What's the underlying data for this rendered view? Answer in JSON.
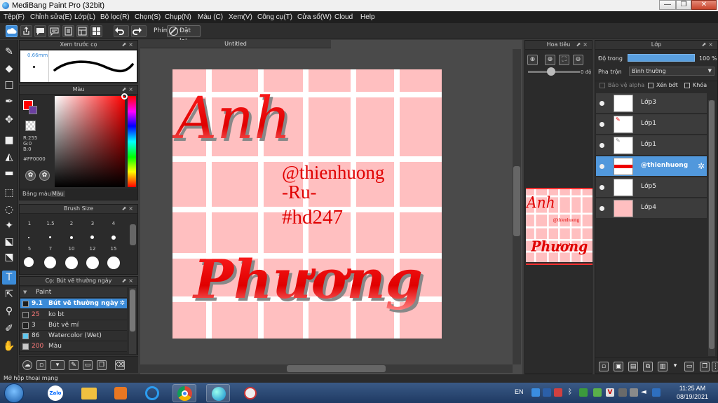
{
  "app": {
    "title": "MediBang Paint Pro (32bit)",
    "window_buttons": [
      "—",
      "❐",
      "✕"
    ]
  },
  "menu": [
    "Tệp(F)",
    "Chỉnh sửa(E)",
    "Lớp(L)",
    "Bộ lọc(R)",
    "Chọn(S)",
    "Chụp(N)",
    "Màu (C)",
    "Xem(V)",
    "Công cụ(T)",
    "Cửa sổ(W)",
    "Cloud",
    "Help"
  ],
  "toolbar": {
    "shortcut_label": "Phím",
    "reset_label": "Đặt lại"
  },
  "brush_preview": {
    "title": "Xem trước cọ",
    "size": "0.66mm"
  },
  "color_panel": {
    "title": "Màu",
    "primary_color": "#ff0000",
    "r": "R:255",
    "g": "G:0",
    "b": "B:0",
    "hex": "#FF0000",
    "tabs": [
      "Bảng màu",
      "Màu"
    ]
  },
  "brush_size": {
    "title": "Brush Size",
    "sizes": [
      "1",
      "1.5",
      "2",
      "3",
      "4",
      "5",
      "7",
      "10",
      "12",
      "15"
    ]
  },
  "brush_list": {
    "title": "Cọ: Bút vẽ thường ngày",
    "group": "Paint",
    "items": [
      {
        "num": "9.1",
        "name": "Bút vẽ thường ngày",
        "color": "#1e1e1e",
        "selected": true
      },
      {
        "num": "25",
        "name": "ko bt",
        "color": "#2a2a2a",
        "selected": false
      },
      {
        "num": "3",
        "name": "Bút vẽ mí",
        "color": "#222222",
        "selected": false
      },
      {
        "num": "86",
        "name": "Watercolor (Wet)",
        "color": "#5ec8f0",
        "selected": false
      },
      {
        "num": "200",
        "name": "Màu",
        "color": "#c8c8c8",
        "selected": false
      }
    ]
  },
  "canvas": {
    "tab_title": "Untitled",
    "art": {
      "word1": "Anh",
      "word2": "Phương",
      "tag1": "@thienhuong",
      "tag2": "-Ru-",
      "tag3": "#hd247"
    }
  },
  "navigator": {
    "title": "Hoa tiêu",
    "angle": "0 độ"
  },
  "layers": {
    "title": "Lớp",
    "opacity_label": "Độ trong",
    "opacity_value": "100 %",
    "opacity": 1.0,
    "blend_label": "Pha trộn",
    "blend_value": "Bình thường",
    "protect_alpha": "Bảo vệ alpha",
    "clipping": "Xén bớt",
    "lock": "Khóa",
    "items": [
      {
        "name": "Lớp3",
        "selected": false
      },
      {
        "name": "Lớp1",
        "selected": false
      },
      {
        "name": "Lớp1",
        "selected": false
      },
      {
        "name": "@thienhuong",
        "selected": true
      },
      {
        "name": "Lớp5",
        "selected": false
      },
      {
        "name": "Lớp4",
        "selected": false
      }
    ]
  },
  "status": {
    "text": "Mở hộp thoại mạng"
  },
  "taskbar": {
    "lang": "EN",
    "time": "11:25 AM",
    "date": "08/19/2021"
  }
}
